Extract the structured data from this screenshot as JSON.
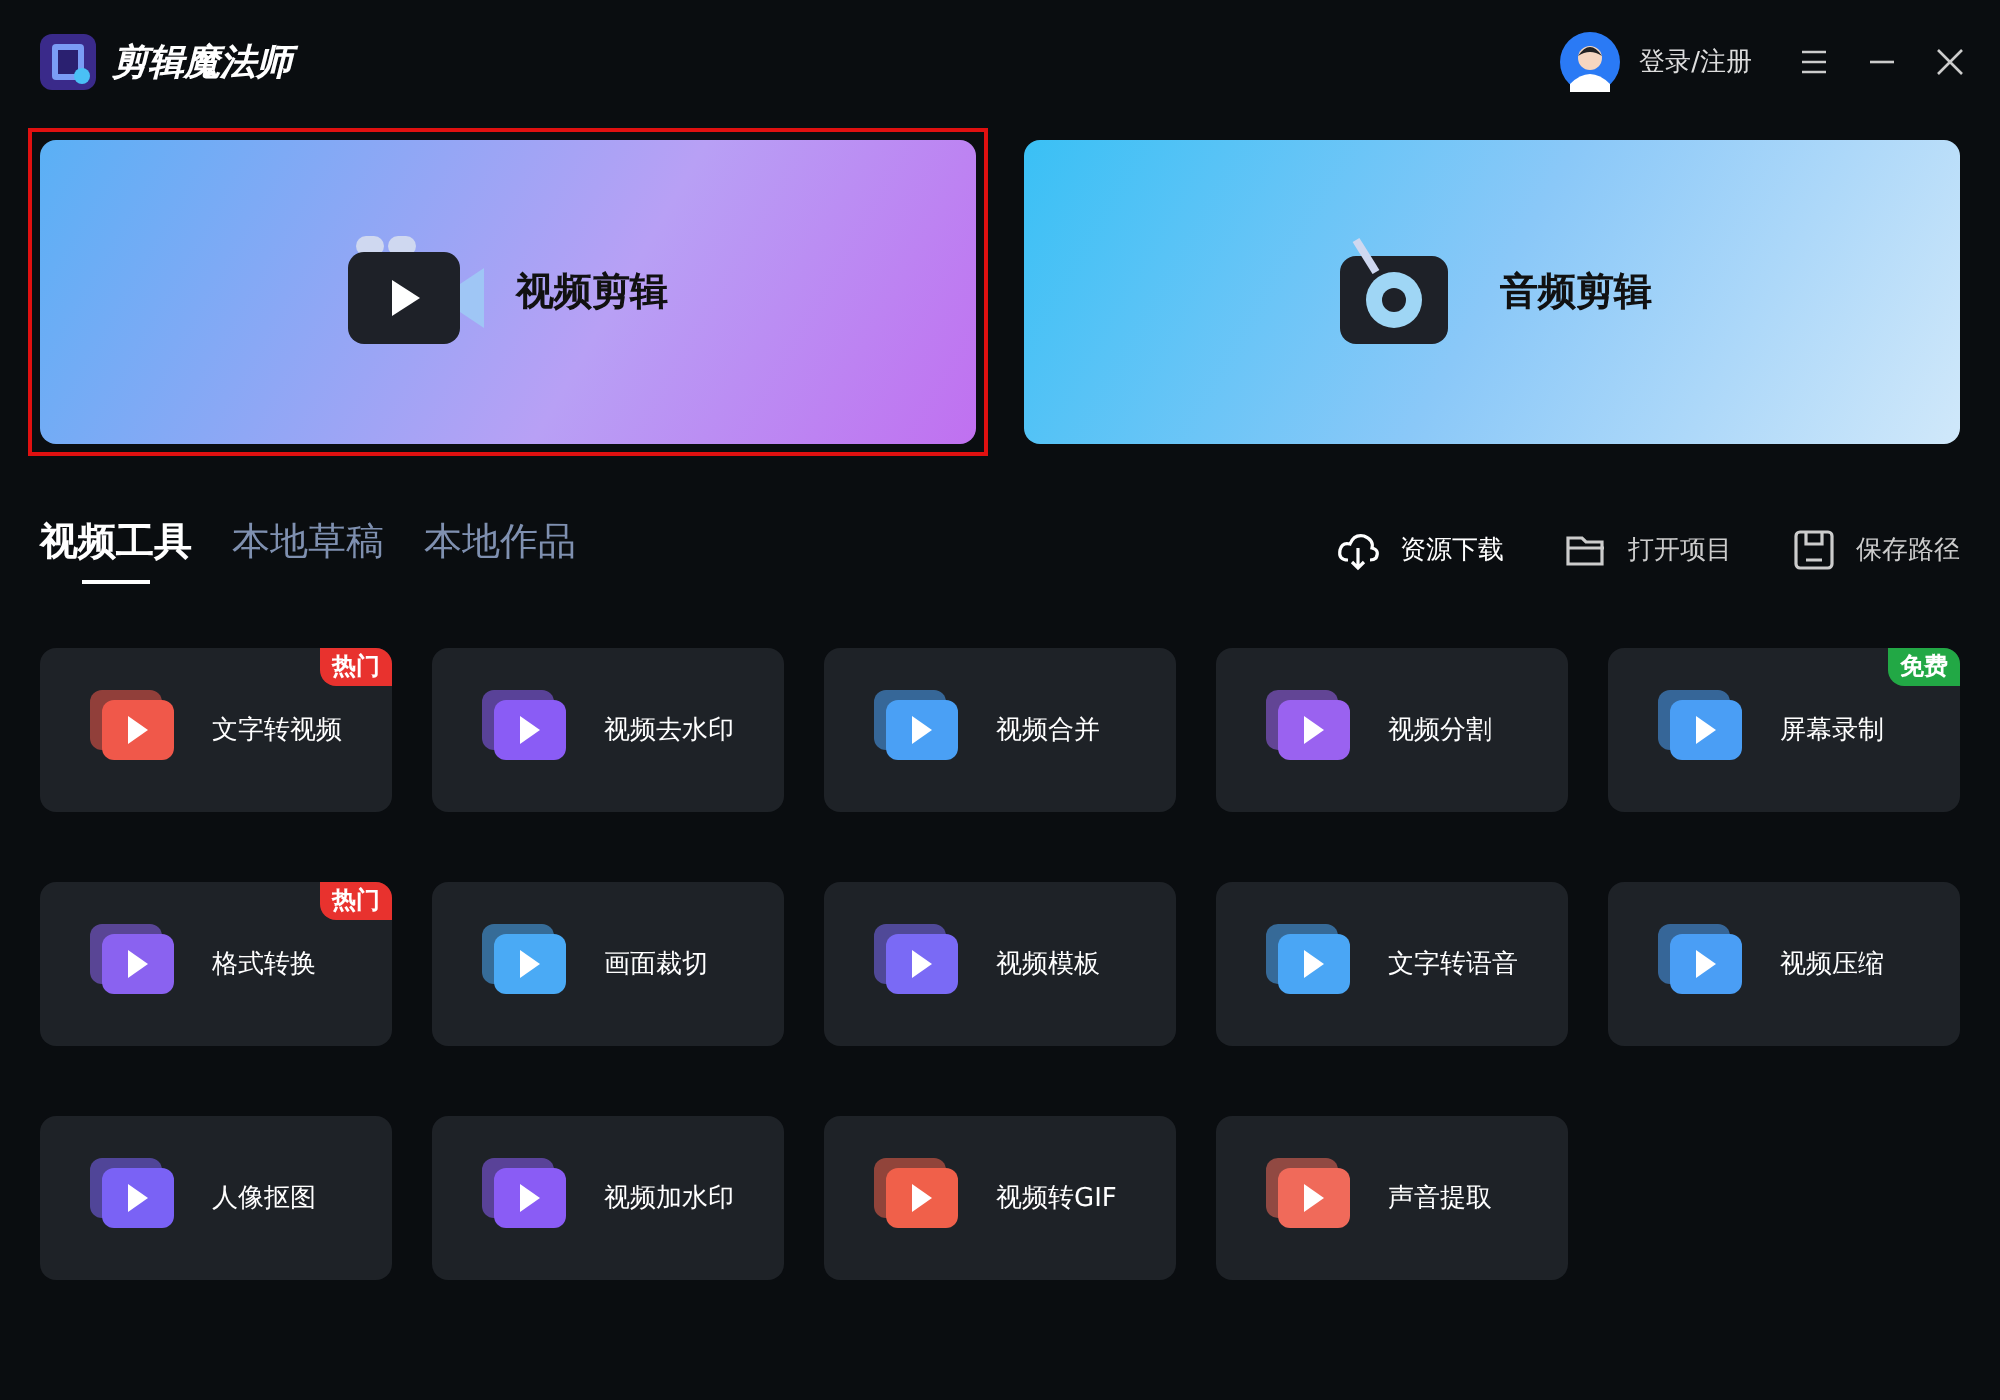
{
  "app": {
    "title": "剪辑魔法师"
  },
  "header": {
    "login": "登录/注册"
  },
  "hero_cards": [
    {
      "label": "视频剪辑",
      "kind": "video",
      "selected": true
    },
    {
      "label": "音频剪辑",
      "kind": "audio",
      "selected": false
    }
  ],
  "tabs": [
    {
      "label": "视频工具",
      "selected": true
    },
    {
      "label": "本地草稿",
      "selected": false
    },
    {
      "label": "本地作品",
      "selected": false
    }
  ],
  "actions": [
    {
      "label": "资源下载",
      "kind": "download"
    },
    {
      "label": "打开项目",
      "kind": "folder"
    },
    {
      "label": "保存路径",
      "kind": "save"
    }
  ],
  "tools": [
    {
      "label": "文字转视频",
      "color": "#f0584a",
      "badge": {
        "text": "热门",
        "kind": "hot"
      }
    },
    {
      "label": "视频去水印",
      "color": "#8a5cf5"
    },
    {
      "label": "视频合并",
      "color": "#4aa0f5"
    },
    {
      "label": "视频分割",
      "color": "#9a62f0"
    },
    {
      "label": "屏幕录制",
      "color": "#4a9ef5",
      "badge": {
        "text": "免费",
        "kind": "free"
      }
    },
    {
      "label": "格式转换",
      "color": "#8a62f0",
      "badge": {
        "text": "热门",
        "kind": "hot"
      }
    },
    {
      "label": "画面裁切",
      "color": "#4aaaf5"
    },
    {
      "label": "视频模板",
      "color": "#7a6af5"
    },
    {
      "label": "文字转语音",
      "color": "#4aa6f5"
    },
    {
      "label": "视频压缩",
      "color": "#4a9ef5"
    },
    {
      "label": "人像抠图",
      "color": "#7a62f5"
    },
    {
      "label": "视频加水印",
      "color": "#8a5cf5"
    },
    {
      "label": "视频转GIF",
      "color": "#f0604a"
    },
    {
      "label": "声音提取",
      "color": "#f06a5a"
    }
  ]
}
